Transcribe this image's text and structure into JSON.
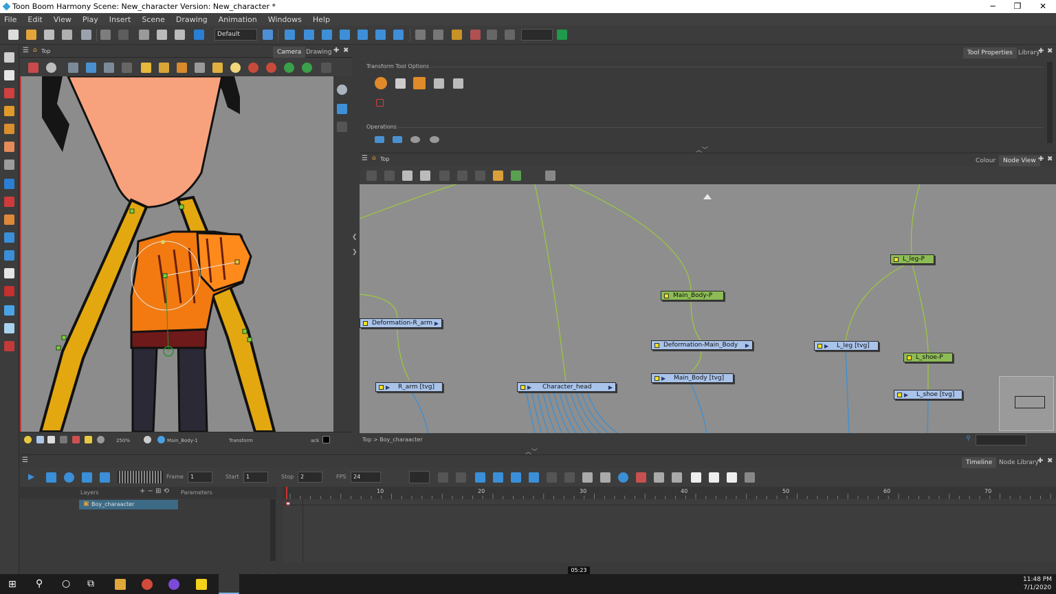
{
  "window": {
    "title": "Toon Boom Harmony Scene: New_character Version: New_character *",
    "minimize": "─",
    "restore": "❐",
    "close": "✕"
  },
  "menu": [
    "File",
    "Edit",
    "View",
    "Play",
    "Insert",
    "Scene",
    "Drawing",
    "Animation",
    "Windows",
    "Help"
  ],
  "toolbar": {
    "workspace": "Default"
  },
  "camera_panel": {
    "breadcrumb": "Top",
    "tabs": [
      "Camera",
      "Drawing"
    ],
    "zoom": "250%",
    "layer": "Main_Body-1",
    "tool": "Transform",
    "mode": "ack"
  },
  "tool_properties": {
    "tabs": [
      "Tool Properties",
      "Library"
    ],
    "section_options": "Transform Tool Options",
    "section_operations": "Operations"
  },
  "node_view": {
    "breadcrumb": "Top",
    "tabs": [
      "Colour",
      "Node View"
    ],
    "path": "Top > Boy_charaacter",
    "nodes": {
      "deformation_r_arm": "Deformation-R_arm",
      "r_arm": "R_arm [tvg]",
      "character_head": "Character_head",
      "main_body_p": "Main_Body-P",
      "deformation_main_body": "Deformation-Main_Body",
      "main_body": "Main_Body [tvg]",
      "l_leg_p": "L_leg-P",
      "l_leg": "L_leg [tvg]",
      "l_shoe_p": "L_shoe-P",
      "l_shoe": "L_shoe [tvg]"
    }
  },
  "timeline": {
    "tabs": [
      "Timeline",
      "Node Library"
    ],
    "frame_label": "Frame",
    "frame_value": "1",
    "start_label": "Start",
    "start_value": "1",
    "stop_label": "Stop",
    "stop_value": "2",
    "fps_label": "FPS",
    "fps_value": "24",
    "layers_label": "Layers",
    "parameters_label": "Parameters",
    "layer_name": "Boy_charaacter",
    "ruler_ticks": [
      "10",
      "20",
      "30",
      "40",
      "50",
      "60",
      "70"
    ]
  },
  "player": {
    "time": "05:23",
    "progress": 0.62
  },
  "taskbar": {
    "time": "11:48 PM",
    "date": "7/1/2020"
  }
}
